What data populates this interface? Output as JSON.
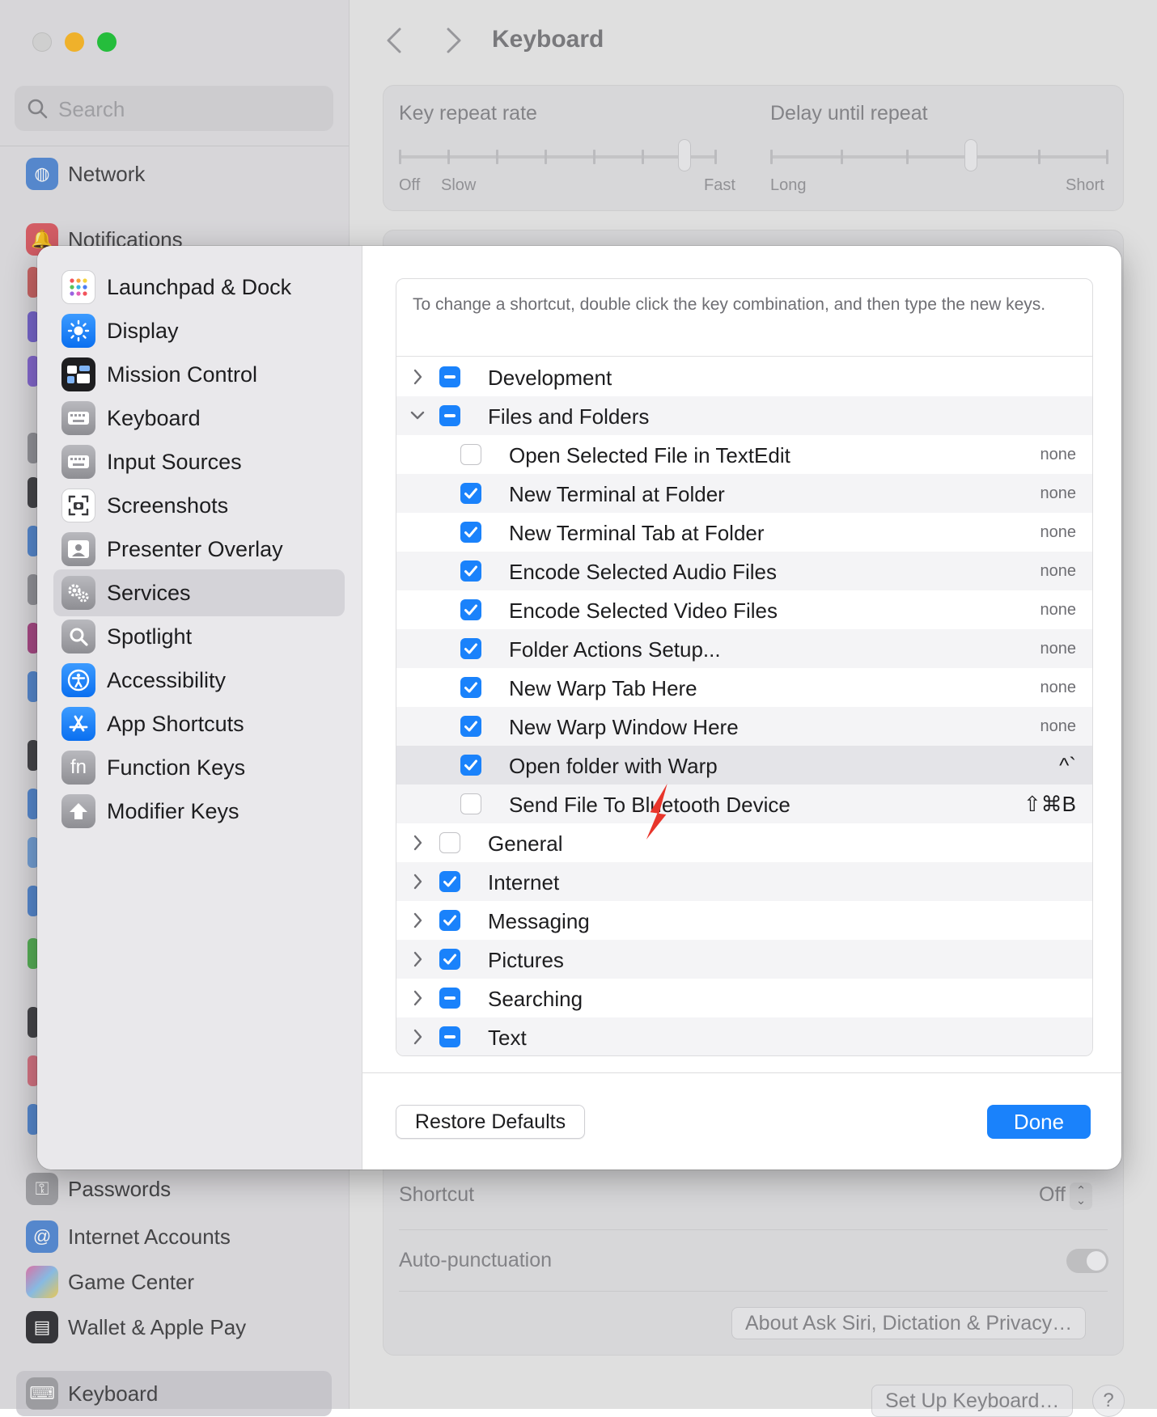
{
  "background": {
    "window_title": "Keyboard",
    "search_placeholder": "Search",
    "sidebar_items": [
      "Network",
      "Notifications",
      "Passwords",
      "Internet Accounts",
      "Game Center",
      "Wallet & Apple Pay",
      "Keyboard"
    ],
    "key_repeat": {
      "label": "Key repeat rate",
      "off": "Off",
      "slow": "Slow",
      "fast": "Fast"
    },
    "delay_repeat": {
      "label": "Delay until repeat",
      "long": "Long",
      "short": "Short"
    },
    "shortcut_label": "Shortcut",
    "shortcut_value": "Off",
    "auto_punctuation_label": "Auto-punctuation",
    "about_button": "About Ask Siri, Dictation & Privacy…",
    "setup_button": "Set Up Keyboard…",
    "help_button": "?"
  },
  "sheet": {
    "categories": [
      {
        "label": "Launchpad & Dock",
        "icon": "launchpad-icon"
      },
      {
        "label": "Display",
        "icon": "display-icon"
      },
      {
        "label": "Mission Control",
        "icon": "mission-control-icon"
      },
      {
        "label": "Keyboard",
        "icon": "keyboard-icon"
      },
      {
        "label": "Input Sources",
        "icon": "input-sources-icon"
      },
      {
        "label": "Screenshots",
        "icon": "screenshots-icon"
      },
      {
        "label": "Presenter Overlay",
        "icon": "presenter-overlay-icon"
      },
      {
        "label": "Services",
        "icon": "services-icon",
        "selected": true
      },
      {
        "label": "Spotlight",
        "icon": "spotlight-icon"
      },
      {
        "label": "Accessibility",
        "icon": "accessibility-icon"
      },
      {
        "label": "App Shortcuts",
        "icon": "app-shortcuts-icon"
      },
      {
        "label": "Function Keys",
        "icon": "function-keys-icon"
      },
      {
        "label": "Modifier Keys",
        "icon": "modifier-keys-icon"
      }
    ],
    "hint": "To change a shortcut, double click the key combination, and then type the new keys.",
    "rows": [
      {
        "label": "Development",
        "state": "mixed",
        "group": true,
        "expanded": false
      },
      {
        "label": "Files and Folders",
        "state": "mixed",
        "group": true,
        "expanded": true
      },
      {
        "label": "Open Selected File in TextEdit",
        "state": "off",
        "shortcut": "none"
      },
      {
        "label": "New Terminal at Folder",
        "state": "on",
        "shortcut": "none"
      },
      {
        "label": "New Terminal Tab at Folder",
        "state": "on",
        "shortcut": "none"
      },
      {
        "label": "Encode Selected Audio Files",
        "state": "on",
        "shortcut": "none"
      },
      {
        "label": "Encode Selected Video Files",
        "state": "on",
        "shortcut": "none"
      },
      {
        "label": "Folder Actions Setup...",
        "state": "on",
        "shortcut": "none"
      },
      {
        "label": "New Warp Tab Here",
        "state": "on",
        "shortcut": "none"
      },
      {
        "label": "New Warp Window Here",
        "state": "on",
        "shortcut": "none"
      },
      {
        "label": "Open folder with Warp",
        "state": "on",
        "shortcut": "^`",
        "highlighted": true
      },
      {
        "label": "Send File To Bluetooth Device",
        "state": "off",
        "shortcut": "⇧⌘B"
      },
      {
        "label": "General",
        "state": "off",
        "group": true,
        "expanded": false
      },
      {
        "label": "Internet",
        "state": "on",
        "group": true,
        "expanded": false
      },
      {
        "label": "Messaging",
        "state": "on",
        "group": true,
        "expanded": false
      },
      {
        "label": "Pictures",
        "state": "on",
        "group": true,
        "expanded": false
      },
      {
        "label": "Searching",
        "state": "mixed",
        "group": true,
        "expanded": false
      },
      {
        "label": "Text",
        "state": "mixed",
        "group": true,
        "expanded": false
      }
    ],
    "restore_defaults": "Restore Defaults",
    "done": "Done"
  },
  "colors": {
    "accent": "#1a82fb",
    "annotation_arrow": "#e8352b"
  }
}
